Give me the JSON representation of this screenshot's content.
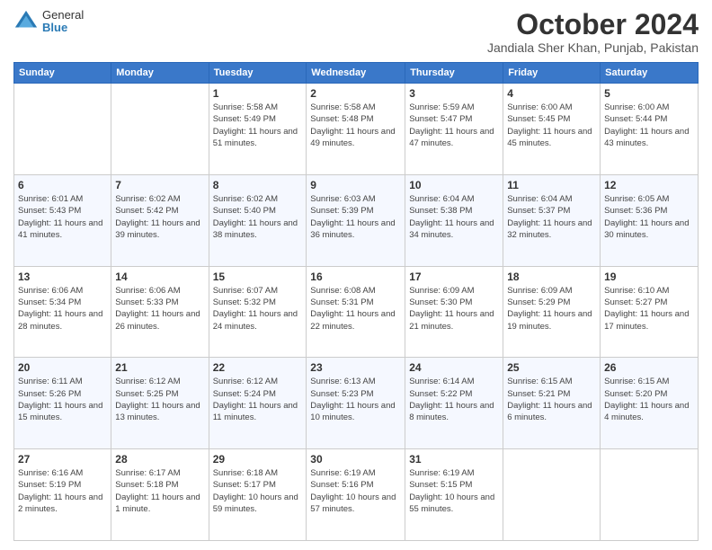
{
  "logo": {
    "general": "General",
    "blue": "Blue"
  },
  "title": "October 2024",
  "location": "Jandiala Sher Khan, Punjab, Pakistan",
  "days_of_week": [
    "Sunday",
    "Monday",
    "Tuesday",
    "Wednesday",
    "Thursday",
    "Friday",
    "Saturday"
  ],
  "weeks": [
    [
      {
        "day": "",
        "info": ""
      },
      {
        "day": "",
        "info": ""
      },
      {
        "day": "1",
        "info": "Sunrise: 5:58 AM\nSunset: 5:49 PM\nDaylight: 11 hours and 51 minutes."
      },
      {
        "day": "2",
        "info": "Sunrise: 5:58 AM\nSunset: 5:48 PM\nDaylight: 11 hours and 49 minutes."
      },
      {
        "day": "3",
        "info": "Sunrise: 5:59 AM\nSunset: 5:47 PM\nDaylight: 11 hours and 47 minutes."
      },
      {
        "day": "4",
        "info": "Sunrise: 6:00 AM\nSunset: 5:45 PM\nDaylight: 11 hours and 45 minutes."
      },
      {
        "day": "5",
        "info": "Sunrise: 6:00 AM\nSunset: 5:44 PM\nDaylight: 11 hours and 43 minutes."
      }
    ],
    [
      {
        "day": "6",
        "info": "Sunrise: 6:01 AM\nSunset: 5:43 PM\nDaylight: 11 hours and 41 minutes."
      },
      {
        "day": "7",
        "info": "Sunrise: 6:02 AM\nSunset: 5:42 PM\nDaylight: 11 hours and 39 minutes."
      },
      {
        "day": "8",
        "info": "Sunrise: 6:02 AM\nSunset: 5:40 PM\nDaylight: 11 hours and 38 minutes."
      },
      {
        "day": "9",
        "info": "Sunrise: 6:03 AM\nSunset: 5:39 PM\nDaylight: 11 hours and 36 minutes."
      },
      {
        "day": "10",
        "info": "Sunrise: 6:04 AM\nSunset: 5:38 PM\nDaylight: 11 hours and 34 minutes."
      },
      {
        "day": "11",
        "info": "Sunrise: 6:04 AM\nSunset: 5:37 PM\nDaylight: 11 hours and 32 minutes."
      },
      {
        "day": "12",
        "info": "Sunrise: 6:05 AM\nSunset: 5:36 PM\nDaylight: 11 hours and 30 minutes."
      }
    ],
    [
      {
        "day": "13",
        "info": "Sunrise: 6:06 AM\nSunset: 5:34 PM\nDaylight: 11 hours and 28 minutes."
      },
      {
        "day": "14",
        "info": "Sunrise: 6:06 AM\nSunset: 5:33 PM\nDaylight: 11 hours and 26 minutes."
      },
      {
        "day": "15",
        "info": "Sunrise: 6:07 AM\nSunset: 5:32 PM\nDaylight: 11 hours and 24 minutes."
      },
      {
        "day": "16",
        "info": "Sunrise: 6:08 AM\nSunset: 5:31 PM\nDaylight: 11 hours and 22 minutes."
      },
      {
        "day": "17",
        "info": "Sunrise: 6:09 AM\nSunset: 5:30 PM\nDaylight: 11 hours and 21 minutes."
      },
      {
        "day": "18",
        "info": "Sunrise: 6:09 AM\nSunset: 5:29 PM\nDaylight: 11 hours and 19 minutes."
      },
      {
        "day": "19",
        "info": "Sunrise: 6:10 AM\nSunset: 5:27 PM\nDaylight: 11 hours and 17 minutes."
      }
    ],
    [
      {
        "day": "20",
        "info": "Sunrise: 6:11 AM\nSunset: 5:26 PM\nDaylight: 11 hours and 15 minutes."
      },
      {
        "day": "21",
        "info": "Sunrise: 6:12 AM\nSunset: 5:25 PM\nDaylight: 11 hours and 13 minutes."
      },
      {
        "day": "22",
        "info": "Sunrise: 6:12 AM\nSunset: 5:24 PM\nDaylight: 11 hours and 11 minutes."
      },
      {
        "day": "23",
        "info": "Sunrise: 6:13 AM\nSunset: 5:23 PM\nDaylight: 11 hours and 10 minutes."
      },
      {
        "day": "24",
        "info": "Sunrise: 6:14 AM\nSunset: 5:22 PM\nDaylight: 11 hours and 8 minutes."
      },
      {
        "day": "25",
        "info": "Sunrise: 6:15 AM\nSunset: 5:21 PM\nDaylight: 11 hours and 6 minutes."
      },
      {
        "day": "26",
        "info": "Sunrise: 6:15 AM\nSunset: 5:20 PM\nDaylight: 11 hours and 4 minutes."
      }
    ],
    [
      {
        "day": "27",
        "info": "Sunrise: 6:16 AM\nSunset: 5:19 PM\nDaylight: 11 hours and 2 minutes."
      },
      {
        "day": "28",
        "info": "Sunrise: 6:17 AM\nSunset: 5:18 PM\nDaylight: 11 hours and 1 minute."
      },
      {
        "day": "29",
        "info": "Sunrise: 6:18 AM\nSunset: 5:17 PM\nDaylight: 10 hours and 59 minutes."
      },
      {
        "day": "30",
        "info": "Sunrise: 6:19 AM\nSunset: 5:16 PM\nDaylight: 10 hours and 57 minutes."
      },
      {
        "day": "31",
        "info": "Sunrise: 6:19 AM\nSunset: 5:15 PM\nDaylight: 10 hours and 55 minutes."
      },
      {
        "day": "",
        "info": ""
      },
      {
        "day": "",
        "info": ""
      }
    ]
  ]
}
